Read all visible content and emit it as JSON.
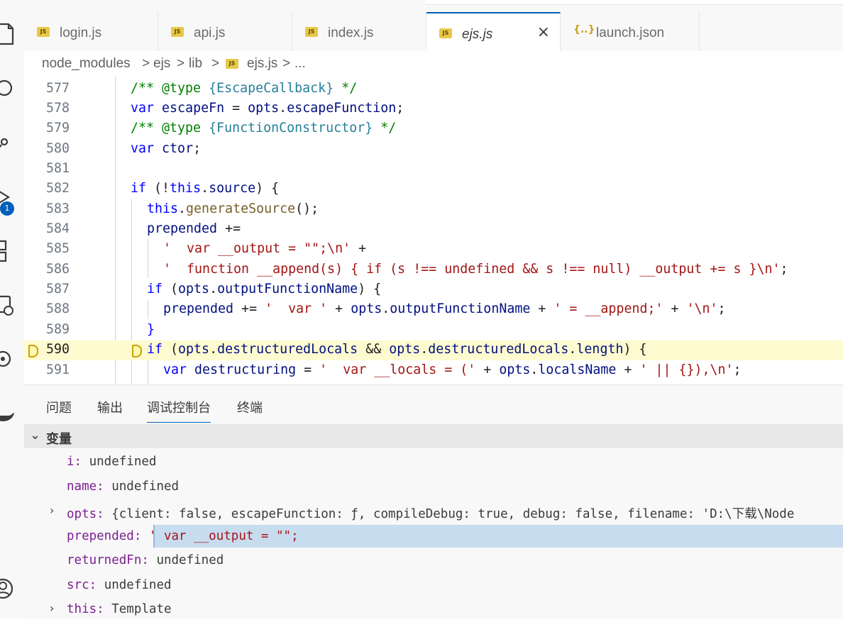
{
  "tabs": [
    {
      "label": "login.js",
      "icon": "JS",
      "active": false
    },
    {
      "label": "api.js",
      "icon": "JS",
      "active": false
    },
    {
      "label": "index.js",
      "icon": "JS",
      "active": false
    },
    {
      "label": "ejs.js",
      "icon": "JS",
      "active": true,
      "close": "×"
    },
    {
      "label": "launch.json",
      "icon": "{..}",
      "active": false
    }
  ],
  "breadcrumb": {
    "items": [
      "node_modules",
      "ejs",
      "lib",
      "ejs.js",
      "..."
    ],
    "separator": ">",
    "file_icon": "JS"
  },
  "activity": {
    "icons": [
      "explorer-icon",
      "search-icon",
      "source-control-icon",
      "run-debug-icon",
      "extensions-icon",
      "remote-icon",
      "copilot-icon",
      "docker-icon",
      "account-icon"
    ],
    "badge": "1"
  },
  "editor": {
    "current_line": "590",
    "lines": [
      {
        "num": "577",
        "text": "/** @type {EscapeCallback} */"
      },
      {
        "num": "578",
        "text": "var escapeFn = opts.escapeFunction;"
      },
      {
        "num": "579",
        "text": "/** @type {FunctionConstructor} */"
      },
      {
        "num": "580",
        "text": "var ctor;"
      },
      {
        "num": "581",
        "text": ""
      },
      {
        "num": "582",
        "text": "if (!this.source) {"
      },
      {
        "num": "583",
        "text": "this.generateSource();"
      },
      {
        "num": "584",
        "text": "prepended +="
      },
      {
        "num": "585",
        "text": "'  var __output = \"\";\\n' +"
      },
      {
        "num": "586",
        "text": "'  function __append(s) { if (s !== undefined && s !== null) __output += s }\\n';"
      },
      {
        "num": "587",
        "text": "if (opts.outputFunctionName) {"
      },
      {
        "num": "588",
        "text": "prepended += '  var ' + opts.outputFunctionName + ' = __append;' + '\\n';"
      },
      {
        "num": "589",
        "text": "}"
      },
      {
        "num": "590",
        "text": "if (opts.destructuredLocals && opts.destructuredLocals.length) {"
      },
      {
        "num": "591",
        "text": "var destructuring = '  var __locals = (' + opts.localsName + ' || {}),\\n';"
      }
    ]
  },
  "panel": {
    "tabs": [
      "问题",
      "输出",
      "调试控制台",
      "终端"
    ],
    "active_tab": "调试控制台",
    "variables_title": "变量",
    "variables": [
      {
        "name": "i:",
        "value": " undefined",
        "expandable": false
      },
      {
        "name": "name:",
        "value": " undefined",
        "expandable": false
      },
      {
        "name": "opts:",
        "value": " {client: false, escapeFunction: ƒ, compileDebug: true, debug: false, filename: 'D:\\下载\\Node",
        "expandable": true
      },
      {
        "name": "prepended:",
        "value": " '  var __output = \"\";",
        "expandable": false,
        "selected": true
      },
      {
        "name": "returnedFn:",
        "value": " undefined",
        "expandable": false
      },
      {
        "name": "src:",
        "value": " undefined",
        "expandable": false
      },
      {
        "name": "this:",
        "value": " Template",
        "expandable": true
      }
    ]
  },
  "colors": {
    "accent": "#005fb8",
    "keyword": "#0000ff",
    "comment": "#008000",
    "string": "#a31515",
    "current_line": "#fffbd0",
    "selection": "#c8dcf0",
    "var_name": "#7c1f91"
  }
}
